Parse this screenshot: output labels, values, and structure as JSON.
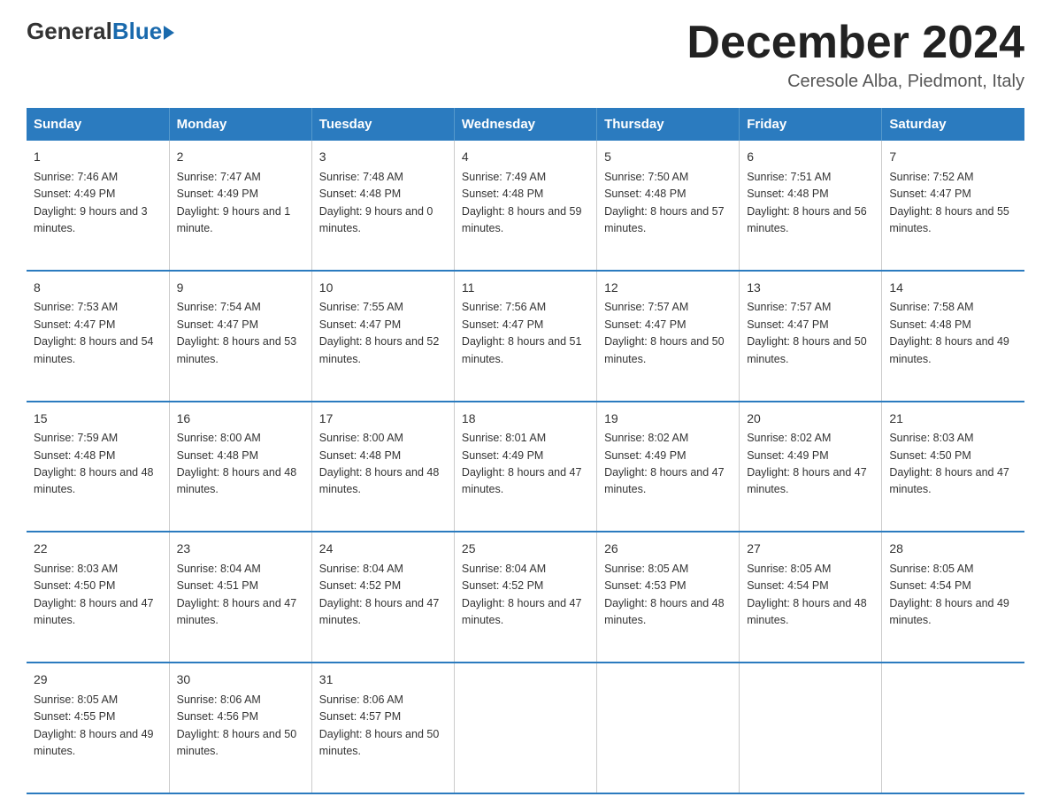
{
  "logo": {
    "general": "General",
    "blue": "Blue"
  },
  "header": {
    "month": "December 2024",
    "location": "Ceresole Alba, Piedmont, Italy"
  },
  "days_of_week": [
    "Sunday",
    "Monday",
    "Tuesday",
    "Wednesday",
    "Thursday",
    "Friday",
    "Saturday"
  ],
  "weeks": [
    [
      {
        "day": "1",
        "sunrise": "7:46 AM",
        "sunset": "4:49 PM",
        "daylight": "9 hours and 3 minutes."
      },
      {
        "day": "2",
        "sunrise": "7:47 AM",
        "sunset": "4:49 PM",
        "daylight": "9 hours and 1 minute."
      },
      {
        "day": "3",
        "sunrise": "7:48 AM",
        "sunset": "4:48 PM",
        "daylight": "9 hours and 0 minutes."
      },
      {
        "day": "4",
        "sunrise": "7:49 AM",
        "sunset": "4:48 PM",
        "daylight": "8 hours and 59 minutes."
      },
      {
        "day": "5",
        "sunrise": "7:50 AM",
        "sunset": "4:48 PM",
        "daylight": "8 hours and 57 minutes."
      },
      {
        "day": "6",
        "sunrise": "7:51 AM",
        "sunset": "4:48 PM",
        "daylight": "8 hours and 56 minutes."
      },
      {
        "day": "7",
        "sunrise": "7:52 AM",
        "sunset": "4:47 PM",
        "daylight": "8 hours and 55 minutes."
      }
    ],
    [
      {
        "day": "8",
        "sunrise": "7:53 AM",
        "sunset": "4:47 PM",
        "daylight": "8 hours and 54 minutes."
      },
      {
        "day": "9",
        "sunrise": "7:54 AM",
        "sunset": "4:47 PM",
        "daylight": "8 hours and 53 minutes."
      },
      {
        "day": "10",
        "sunrise": "7:55 AM",
        "sunset": "4:47 PM",
        "daylight": "8 hours and 52 minutes."
      },
      {
        "day": "11",
        "sunrise": "7:56 AM",
        "sunset": "4:47 PM",
        "daylight": "8 hours and 51 minutes."
      },
      {
        "day": "12",
        "sunrise": "7:57 AM",
        "sunset": "4:47 PM",
        "daylight": "8 hours and 50 minutes."
      },
      {
        "day": "13",
        "sunrise": "7:57 AM",
        "sunset": "4:47 PM",
        "daylight": "8 hours and 50 minutes."
      },
      {
        "day": "14",
        "sunrise": "7:58 AM",
        "sunset": "4:48 PM",
        "daylight": "8 hours and 49 minutes."
      }
    ],
    [
      {
        "day": "15",
        "sunrise": "7:59 AM",
        "sunset": "4:48 PM",
        "daylight": "8 hours and 48 minutes."
      },
      {
        "day": "16",
        "sunrise": "8:00 AM",
        "sunset": "4:48 PM",
        "daylight": "8 hours and 48 minutes."
      },
      {
        "day": "17",
        "sunrise": "8:00 AM",
        "sunset": "4:48 PM",
        "daylight": "8 hours and 48 minutes."
      },
      {
        "day": "18",
        "sunrise": "8:01 AM",
        "sunset": "4:49 PM",
        "daylight": "8 hours and 47 minutes."
      },
      {
        "day": "19",
        "sunrise": "8:02 AM",
        "sunset": "4:49 PM",
        "daylight": "8 hours and 47 minutes."
      },
      {
        "day": "20",
        "sunrise": "8:02 AM",
        "sunset": "4:49 PM",
        "daylight": "8 hours and 47 minutes."
      },
      {
        "day": "21",
        "sunrise": "8:03 AM",
        "sunset": "4:50 PM",
        "daylight": "8 hours and 47 minutes."
      }
    ],
    [
      {
        "day": "22",
        "sunrise": "8:03 AM",
        "sunset": "4:50 PM",
        "daylight": "8 hours and 47 minutes."
      },
      {
        "day": "23",
        "sunrise": "8:04 AM",
        "sunset": "4:51 PM",
        "daylight": "8 hours and 47 minutes."
      },
      {
        "day": "24",
        "sunrise": "8:04 AM",
        "sunset": "4:52 PM",
        "daylight": "8 hours and 47 minutes."
      },
      {
        "day": "25",
        "sunrise": "8:04 AM",
        "sunset": "4:52 PM",
        "daylight": "8 hours and 47 minutes."
      },
      {
        "day": "26",
        "sunrise": "8:05 AM",
        "sunset": "4:53 PM",
        "daylight": "8 hours and 48 minutes."
      },
      {
        "day": "27",
        "sunrise": "8:05 AM",
        "sunset": "4:54 PM",
        "daylight": "8 hours and 48 minutes."
      },
      {
        "day": "28",
        "sunrise": "8:05 AM",
        "sunset": "4:54 PM",
        "daylight": "8 hours and 49 minutes."
      }
    ],
    [
      {
        "day": "29",
        "sunrise": "8:05 AM",
        "sunset": "4:55 PM",
        "daylight": "8 hours and 49 minutes."
      },
      {
        "day": "30",
        "sunrise": "8:06 AM",
        "sunset": "4:56 PM",
        "daylight": "8 hours and 50 minutes."
      },
      {
        "day": "31",
        "sunrise": "8:06 AM",
        "sunset": "4:57 PM",
        "daylight": "8 hours and 50 minutes."
      },
      null,
      null,
      null,
      null
    ]
  ]
}
